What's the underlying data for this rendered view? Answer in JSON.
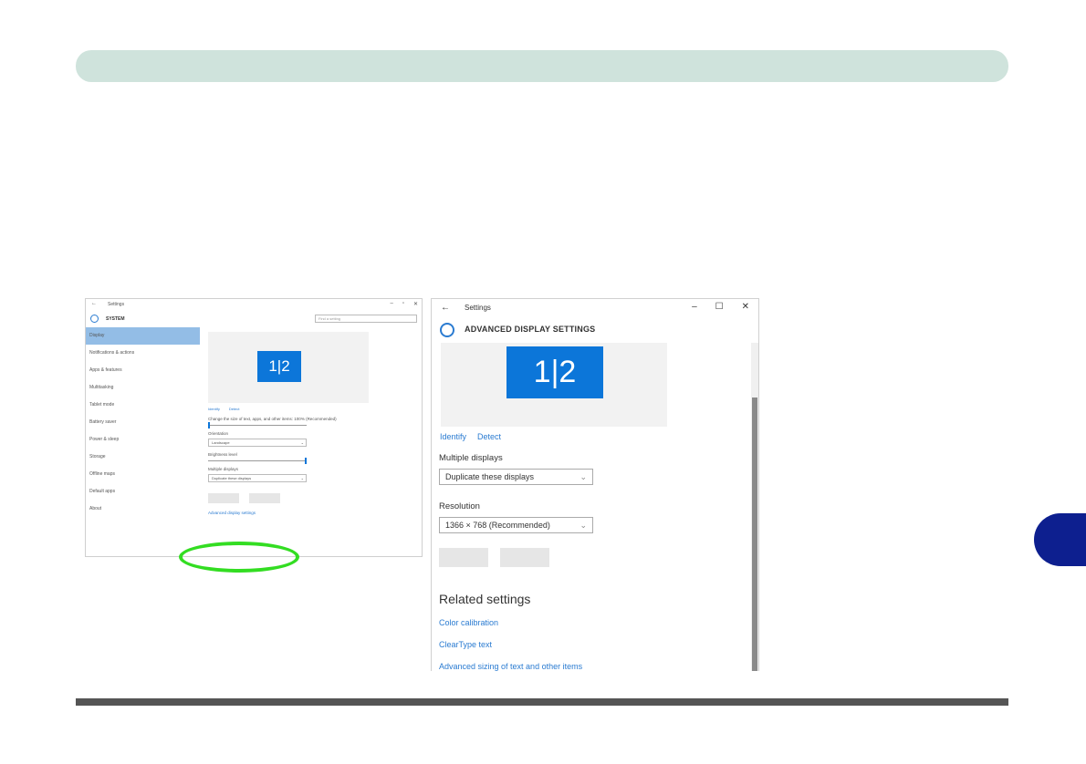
{
  "colors": {
    "header_bar": "#cfe3dc",
    "chapter_tab": "#0d1f8f",
    "accent": "#0c76d9",
    "link": "#2a7bd1",
    "highlight_oval": "#33dd22"
  },
  "left_window": {
    "title": "Settings",
    "system_title": "SYSTEM",
    "search_placeholder": "Find a setting",
    "sidebar": [
      "Display",
      "Notifications & actions",
      "Apps & features",
      "Multitasking",
      "Tablet mode",
      "Battery saver",
      "Power & sleep",
      "Storage",
      "Offline maps",
      "Default apps",
      "About"
    ],
    "monitor_label": "1|2",
    "identify": "Identify",
    "detect": "Detect",
    "scale_label": "Change the size of text, apps, and other items: 100% (Recommended)",
    "scale_value": 0,
    "orientation_label": "Orientation",
    "orientation_value": "Landscape",
    "brightness_label": "Brightness level",
    "brightness_value": 1,
    "multiple_label": "Multiple displays",
    "multiple_value": "Duplicate these displays",
    "advanced_link": "Advanced display settings"
  },
  "right_window": {
    "title": "Settings",
    "heading": "ADVANCED DISPLAY SETTINGS",
    "monitor_label": "1|2",
    "identify": "Identify",
    "detect": "Detect",
    "multiple_label": "Multiple displays",
    "multiple_value": "Duplicate these displays",
    "resolution_label": "Resolution",
    "resolution_value": "1366 × 768 (Recommended)",
    "related_heading": "Related settings",
    "related_links": [
      "Color calibration",
      "ClearType text",
      "Advanced sizing of text and other items"
    ]
  }
}
